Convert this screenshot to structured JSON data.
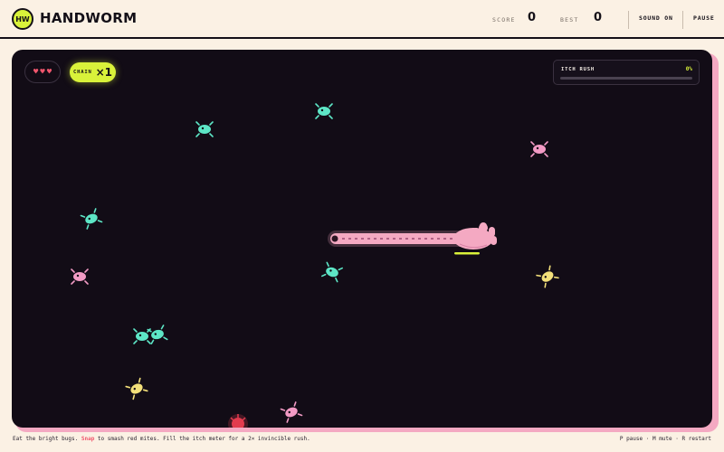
{
  "header": {
    "logo_text": "HW",
    "title": "HANDWORM",
    "score_label": "SCORE",
    "score": "0",
    "best_label": "BEST",
    "best": "0",
    "sound_button": "SOUND ON",
    "pause_button": "PAUSE"
  },
  "hud": {
    "lives": 3,
    "heart_glyph": "♥",
    "chain_label": "CHAIN",
    "chain_value": "×1",
    "meter_label": "ITCH RUSH",
    "meter_value": "0%",
    "meter_fraction": 0
  },
  "colors": {
    "bright_bug": "#5de6c6",
    "snack_bug": "#f29ac4",
    "gold_bug": "#f3e07a",
    "red_mite": "#e23b4e",
    "accent": "#d9f23a",
    "worm": "#f4a9c2"
  },
  "footer": {
    "hint_before": "Eat the bright bugs. ",
    "hint_snap": "Snap",
    "hint_after": " to smash red mites. Fill the itch meter for a 2× invincible rush.",
    "keys": "P pause · M mute · R restart"
  }
}
